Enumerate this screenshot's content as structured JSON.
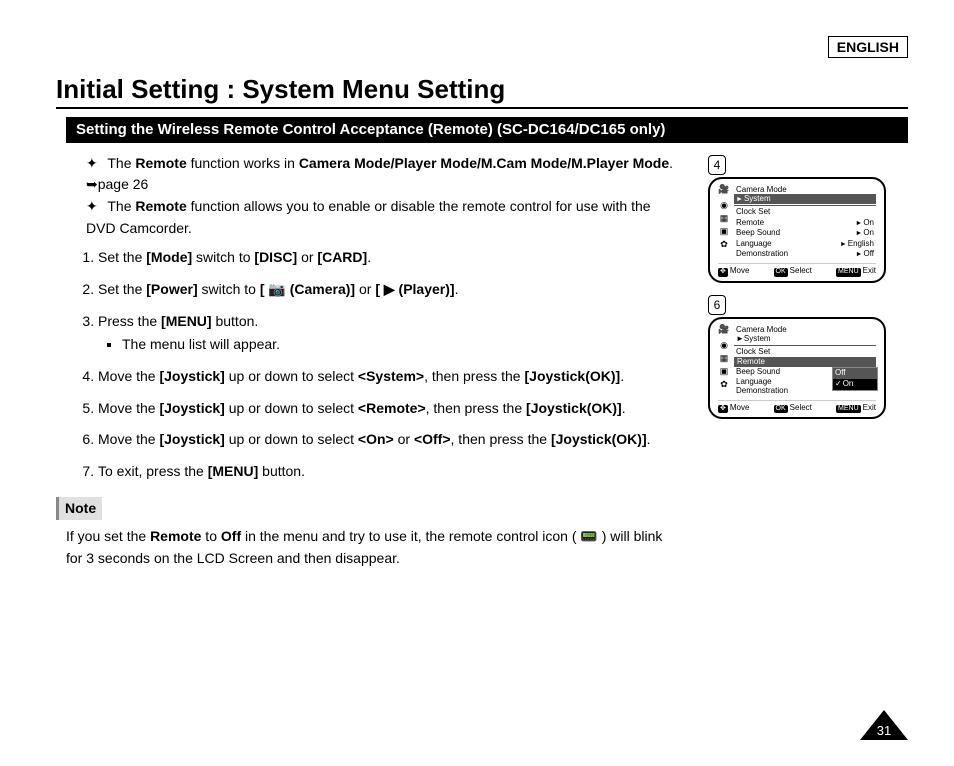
{
  "language_tag": "ENGLISH",
  "page_title": "Initial Setting : System Menu Setting",
  "section_bar": "Setting the Wireless Remote Control Acceptance (Remote) (SC-DC164/DC165 only)",
  "intro": {
    "line1_pre": "The ",
    "line1_b1": "Remote",
    "line1_mid": " function works in ",
    "line1_b2": "Camera Mode/Player Mode/M.Cam Mode/M.Player Mode",
    "line1_post": ". ➥page 26",
    "line2_pre": "The ",
    "line2_b": "Remote",
    "line2_post": " function allows you to enable or disable the remote control for use with the DVD Camcorder."
  },
  "steps": {
    "s1_a": "Set the ",
    "s1_b1": "[Mode]",
    "s1_b": " switch to ",
    "s1_b2": "[DISC]",
    "s1_c": " or ",
    "s1_b3": "[CARD]",
    "s1_d": ".",
    "s2_a": "Set the ",
    "s2_b1": "[Power]",
    "s2_b": " switch to ",
    "s2_b2": "[ 📷 (Camera)]",
    "s2_c": " or ",
    "s2_b3": "[ ▶ (Player)]",
    "s2_d": ".",
    "s3_a": "Press the ",
    "s3_b1": "[MENU]",
    "s3_b": " button.",
    "s3_sub": "The menu list will appear.",
    "s4_a": "Move the ",
    "s4_b1": "[Joystick]",
    "s4_b": " up or down to select ",
    "s4_b2": "<System>",
    "s4_c": ", then press the ",
    "s4_b3": "[Joystick(OK)]",
    "s4_d": ".",
    "s5_a": "Move the ",
    "s5_b1": "[Joystick]",
    "s5_b": " up or down to select ",
    "s5_b2": "<Remote>",
    "s5_c": ", then press the ",
    "s5_b3": "[Joystick(OK)]",
    "s5_d": ".",
    "s6_a": "Move the ",
    "s6_b1": "[Joystick]",
    "s6_b": " up or down to select ",
    "s6_b2": "<On>",
    "s6_c": " or ",
    "s6_b3": "<Off>",
    "s6_d": ", then press the ",
    "s6_b4": "[Joystick(OK)]",
    "s6_e": ".",
    "s7_a": "To exit, press the ",
    "s7_b1": "[MENU]",
    "s7_b": " button."
  },
  "note": {
    "label": "Note",
    "t1": "If you set the ",
    "b1": "Remote",
    "t2": " to ",
    "b2": "Off",
    "t3": " in the menu and try to use it, the remote control icon ( 📟 ) will blink for 3 seconds on the LCD Screen and then disappear."
  },
  "lcd4": {
    "ref": "4",
    "title": "Camera Mode",
    "highlight": "System",
    "rows": [
      {
        "label": "Clock Set",
        "value": ""
      },
      {
        "label": "Remote",
        "value": "On"
      },
      {
        "label": "Beep Sound",
        "value": "On"
      },
      {
        "label": "Language",
        "value": "English"
      },
      {
        "label": "Demonstration",
        "value": "Off"
      }
    ],
    "foot": {
      "move": "Move",
      "select": "Select",
      "exit": "Exit",
      "menu_btn": "MENU",
      "ok_btn": "OK",
      "dpad": "✥"
    }
  },
  "lcd6": {
    "ref": "6",
    "title": "Camera Mode",
    "highlight": "System",
    "rows": [
      {
        "label": "Clock Set"
      },
      {
        "label": "Remote"
      },
      {
        "label": "Beep Sound"
      },
      {
        "label": "Language"
      },
      {
        "label": "Demonstration"
      }
    ],
    "options": {
      "off": "Off",
      "on": "On"
    },
    "foot": {
      "move": "Move",
      "select": "Select",
      "exit": "Exit",
      "menu_btn": "MENU",
      "ok_btn": "OK",
      "dpad": "✥"
    }
  },
  "icons": {
    "cam": "🎥",
    "gear": "✿",
    "disc": "◉",
    "tv": "▣",
    "mem": "▦"
  },
  "page_number": "31"
}
